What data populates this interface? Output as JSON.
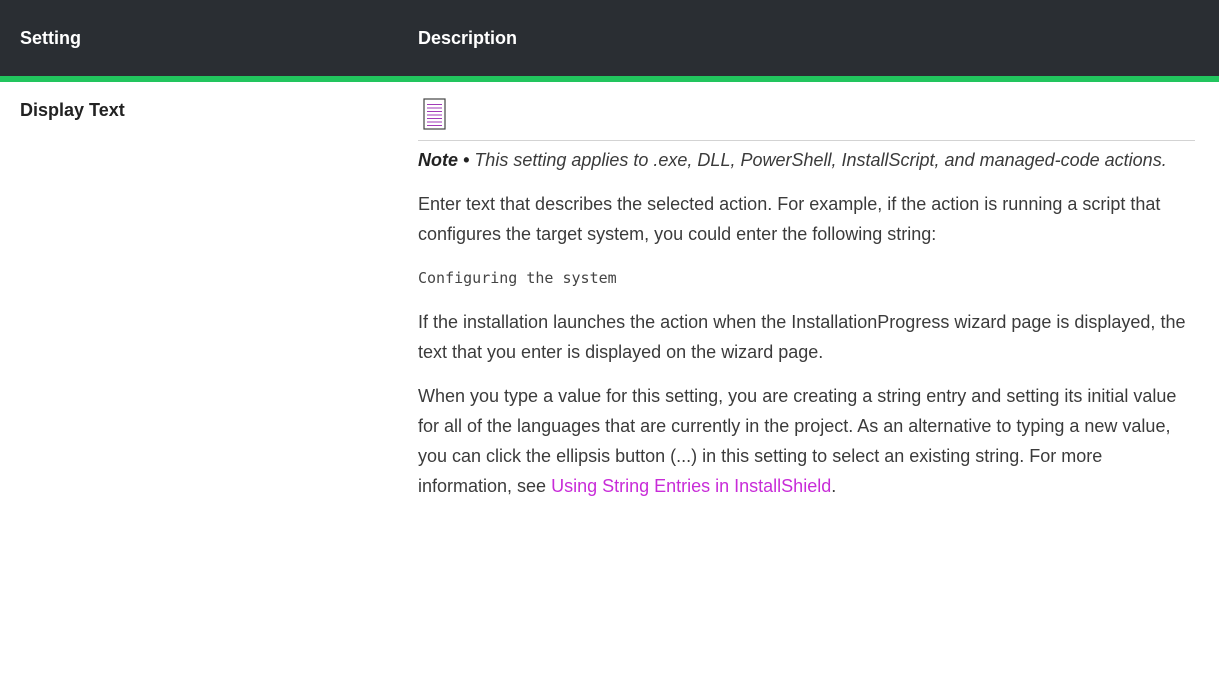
{
  "table": {
    "headers": {
      "setting": "Setting",
      "description": "Description"
    },
    "row": {
      "setting": "Display Text",
      "note": {
        "icon": "note-icon",
        "label": "Note •",
        "text": " This setting applies to .exe, DLL, PowerShell, InstallScript, and managed-code actions."
      },
      "para1": "Enter text that describes the selected action. For example, if the action is running a script that configures the target system, you could enter the following string:",
      "code_example": "Configuring the system",
      "para2": "If the installation launches the action when the InstallationProgress wizard page is displayed, the text that you enter is displayed on the wizard page.",
      "para3_text": "When you type a value for this setting, you are creating a string entry and setting its initial value for all of the languages that are currently in the project. As an alternative to typing a new value, you can click the ellipsis button (...) in this setting to select an existing string. For more information, see ",
      "para3_link": "Using String Entries in InstallShield",
      "para3_end": "."
    }
  },
  "colors": {
    "header_bg": "#2a2e33",
    "header_accent": "#22c55e",
    "link": "#c82cd8",
    "icon_accent": "#a23bb8"
  }
}
